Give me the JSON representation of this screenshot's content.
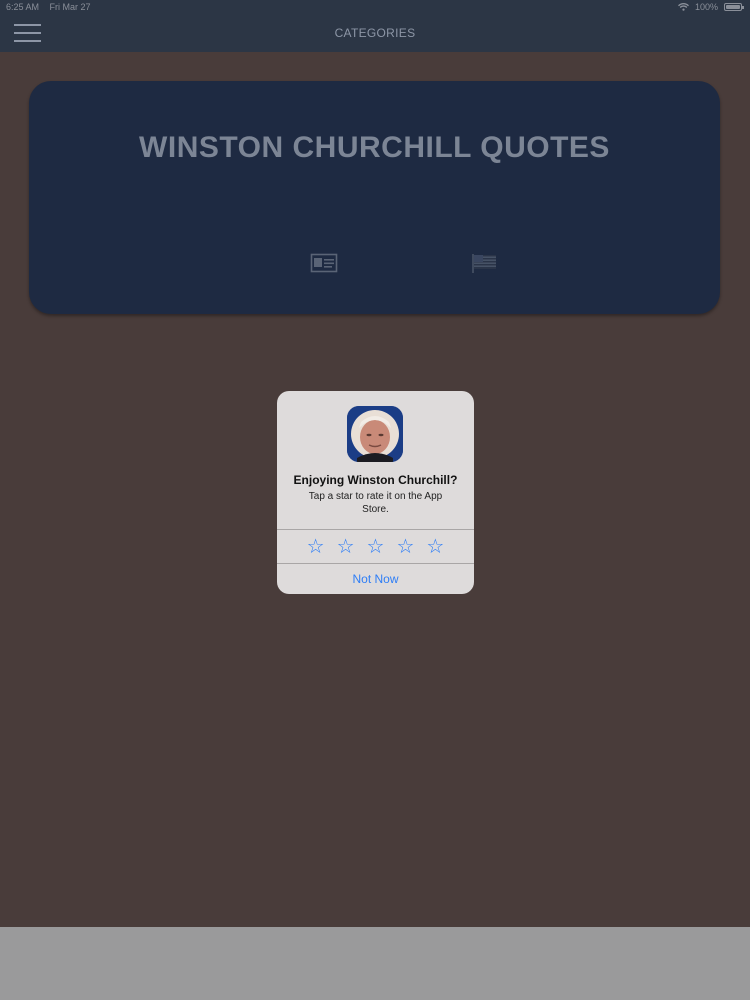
{
  "status_bar": {
    "time": "6:25 AM",
    "date": "Fri Mar 27",
    "battery": "100%",
    "wifi_icon": "wifi-icon",
    "battery_icon": "battery-icon"
  },
  "navbar": {
    "menu_icon": "hamburger-menu-icon",
    "title": "CATEGORIES"
  },
  "card": {
    "title": "WINSTON CHURCHILL QUOTES",
    "icons": [
      "id-card-icon",
      "flag-icon"
    ]
  },
  "rating_dialog": {
    "title": "Enjoying Winston Churchill?",
    "message": "Tap a star to rate it on the App Store.",
    "stars": [
      "☆",
      "☆",
      "☆",
      "☆",
      "☆"
    ],
    "dismiss_label": "Not Now",
    "accent_color": "#2f7ef6"
  },
  "colors": {
    "background": "#493c3a",
    "navbar": "#2c3645",
    "card": "#1e2a42",
    "dialog": "#dedbdb"
  }
}
